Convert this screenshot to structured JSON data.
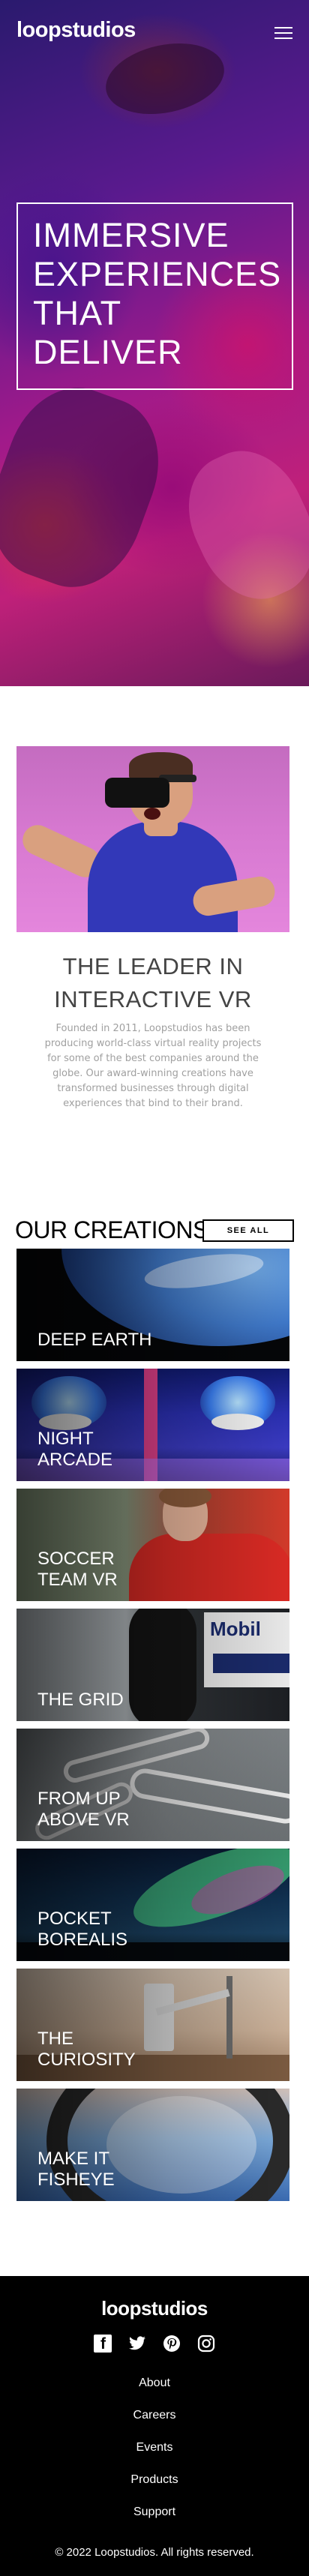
{
  "header": {
    "logo": "loopstudios",
    "menu_icon": "hamburger-menu-icon"
  },
  "hero": {
    "title_lines": [
      "IMMERSIVE",
      "EXPERIENCES",
      "THAT",
      "DELIVER"
    ]
  },
  "intro": {
    "title_lines": [
      "THE LEADER IN",
      "INTERACTIVE VR"
    ],
    "body": "Founded in 2011, Loopstudios has been producing world-class virtual reality projects for some of the best companies around the globe. Our award-winning creations have transformed businesses through digital experiences that bind to their brand."
  },
  "creations": {
    "title": "OUR CREATIONS",
    "see_all": "SEE ALL",
    "items": [
      {
        "lines": [
          "DEEP EARTH"
        ]
      },
      {
        "lines": [
          "NIGHT",
          "ARCADE"
        ]
      },
      {
        "lines": [
          "SOCCER",
          "TEAM VR"
        ]
      },
      {
        "lines": [
          "THE GRID"
        ]
      },
      {
        "lines": [
          "FROM UP",
          "ABOVE VR"
        ]
      },
      {
        "lines": [
          "POCKET",
          "BOREALIS"
        ]
      },
      {
        "lines": [
          "THE",
          "CURIOSITY"
        ]
      },
      {
        "lines": [
          "MAKE IT",
          "FISHEYE"
        ]
      }
    ]
  },
  "footer": {
    "logo": "loopstudios",
    "social_icons": [
      "facebook-icon",
      "twitter-icon",
      "pinterest-icon",
      "instagram-icon"
    ],
    "nav": [
      "About",
      "Careers",
      "Events",
      "Products",
      "Support"
    ],
    "copyright": "© 2022 Loopstudios. All rights reserved."
  },
  "colors": {
    "footer_bg": "#000000",
    "body_text": "#a0a0a0",
    "heading": "#444444"
  }
}
